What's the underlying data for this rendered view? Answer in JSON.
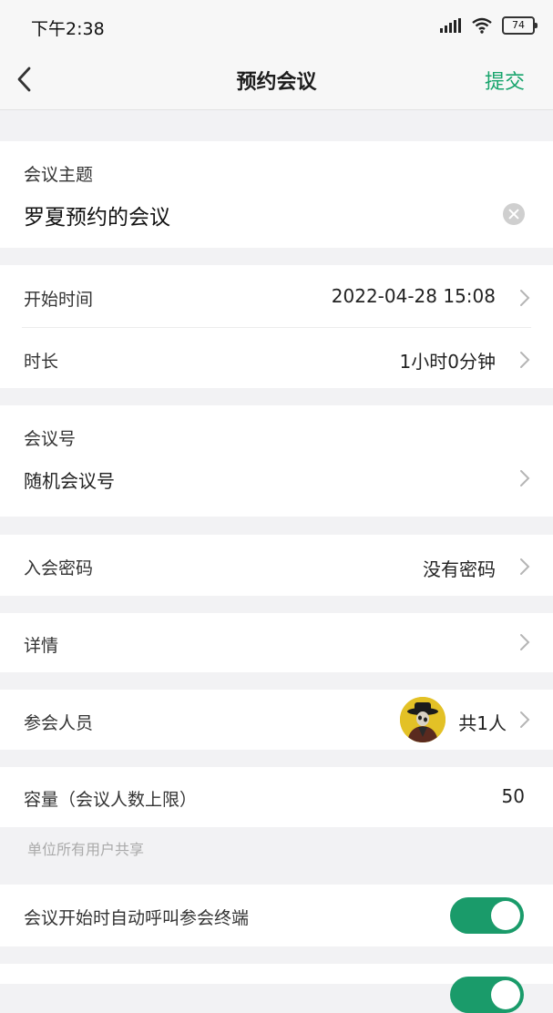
{
  "status_bar": {
    "time": "下午2:38",
    "battery": "74",
    "icons": [
      "signal-icon",
      "wifi-icon",
      "battery-icon"
    ]
  },
  "nav": {
    "title": "预约会议",
    "submit": "提交",
    "back_icon": "chevron-left-icon"
  },
  "topic": {
    "label": "会议主题",
    "value": "罗夏预约的会议"
  },
  "start_time": {
    "label": "开始时间",
    "value": "2022-04-28 15:08"
  },
  "duration": {
    "label": "时长",
    "value": "1小时0分钟"
  },
  "meeting_id": {
    "label": "会议号",
    "value": "随机会议号"
  },
  "password": {
    "label": "入会密码",
    "value": "没有密码"
  },
  "details": {
    "label": "详情"
  },
  "participants": {
    "label": "参会人员",
    "value": "共1人"
  },
  "capacity": {
    "label": "容量（会议人数上限）",
    "value": "50",
    "hint": "单位所有用户共享"
  },
  "auto_call": {
    "label": "会议开始时自动呼叫参会终端",
    "enabled": true
  },
  "colors": {
    "accent": "#17a46c",
    "toggle_on": "#1a9b6a",
    "background": "#f2f2f4"
  }
}
